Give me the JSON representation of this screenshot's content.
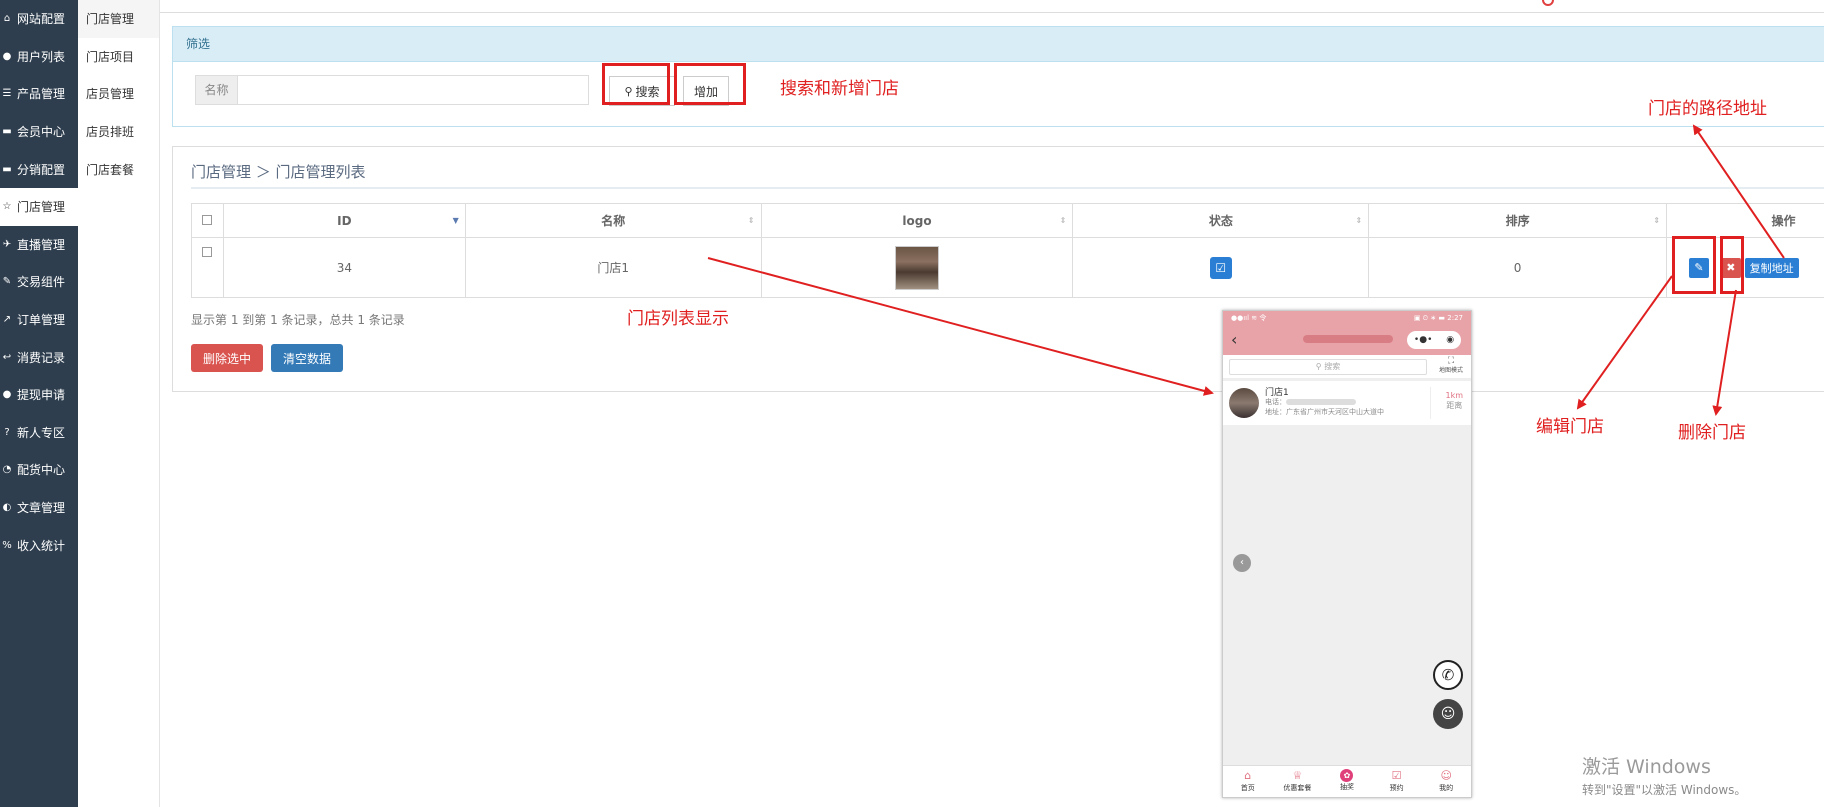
{
  "sidebar": {
    "items": [
      {
        "icon": "home-icon",
        "glyph": "⌂",
        "label": "网站配置"
      },
      {
        "icon": "user-icon",
        "glyph": "●",
        "label": "用户列表"
      },
      {
        "icon": "list-icon",
        "glyph": "☰",
        "label": "产品管理"
      },
      {
        "icon": "cart-icon",
        "glyph": "▬",
        "label": "会员中心"
      },
      {
        "icon": "cart-icon",
        "glyph": "▬",
        "label": "分销配置"
      },
      {
        "icon": "star-icon",
        "glyph": "☆",
        "label": "门店管理"
      },
      {
        "icon": "plane-icon",
        "glyph": "✈",
        "label": "直播管理"
      },
      {
        "icon": "pen-icon",
        "glyph": "✎",
        "label": "交易组件"
      },
      {
        "icon": "share-icon",
        "glyph": "↗",
        "label": "订单管理"
      },
      {
        "icon": "reply-icon",
        "glyph": "↩",
        "label": "消费记录"
      },
      {
        "icon": "comments-icon",
        "glyph": "●",
        "label": "提现申请"
      },
      {
        "icon": "question-icon",
        "glyph": "?",
        "label": "新人专区"
      },
      {
        "icon": "pie-icon",
        "glyph": "◔",
        "label": "配货中心"
      },
      {
        "icon": "circle-half-icon",
        "glyph": "◐",
        "label": "文章管理"
      },
      {
        "icon": "percent-icon",
        "glyph": "%",
        "label": "收入统计"
      }
    ]
  },
  "subnav": {
    "items": [
      "门店管理",
      "门店项目",
      "店员管理",
      "店员排班",
      "门店套餐"
    ]
  },
  "filter": {
    "title": "筛选",
    "name_label": "名称",
    "name_value": "",
    "search_label": "搜索",
    "add_label": "增加"
  },
  "list": {
    "breadcrumb": "门店管理 ＞ 门店管理列表",
    "columns": {
      "id": "ID",
      "name": "名称",
      "logo": "logo",
      "status": "状态",
      "sort": "排序",
      "ops": "操作"
    },
    "rows": [
      {
        "id": "34",
        "name": "门店1",
        "sort": "0",
        "copy_label": "复制地址"
      }
    ],
    "records_text": "显示第 1 到第 1 条记录，总共 1 条记录",
    "delete_selected": "删除选中",
    "clear_data": "清空数据"
  },
  "annotations": {
    "search_add": "搜索和新增门店",
    "list_display": "门店列表显示",
    "path_address": "门店的路径地址",
    "edit_store": "编辑门店",
    "delete_store": "删除门店"
  },
  "phone": {
    "status_left": "●●ııl ≋ 令",
    "status_right": "▣ ⏲ ∗ ▬ 2:27",
    "capsule_dots": "•●•",
    "capsule_target": "◉",
    "search_placeholder": "搜索",
    "map_label": "地图模式",
    "store": {
      "name": "门店1",
      "phone_label": "电话：",
      "address": "地址：广东省广州市天河区中山大道中",
      "distance": "1km",
      "distance_label": "距离"
    },
    "tabs": [
      "首页",
      "优惠套餐",
      "抽奖",
      "预约",
      "我的"
    ]
  },
  "watermark": {
    "line1": "激活 Windows",
    "line2": "转到\"设置\"以激活 Windows。"
  },
  "colors": {
    "sidebar_bg": "#2e3e4e",
    "primary": "#2a7fd4",
    "danger": "#d9534f",
    "annotation": "#e02020",
    "phone_header": "#e8a3a8"
  }
}
